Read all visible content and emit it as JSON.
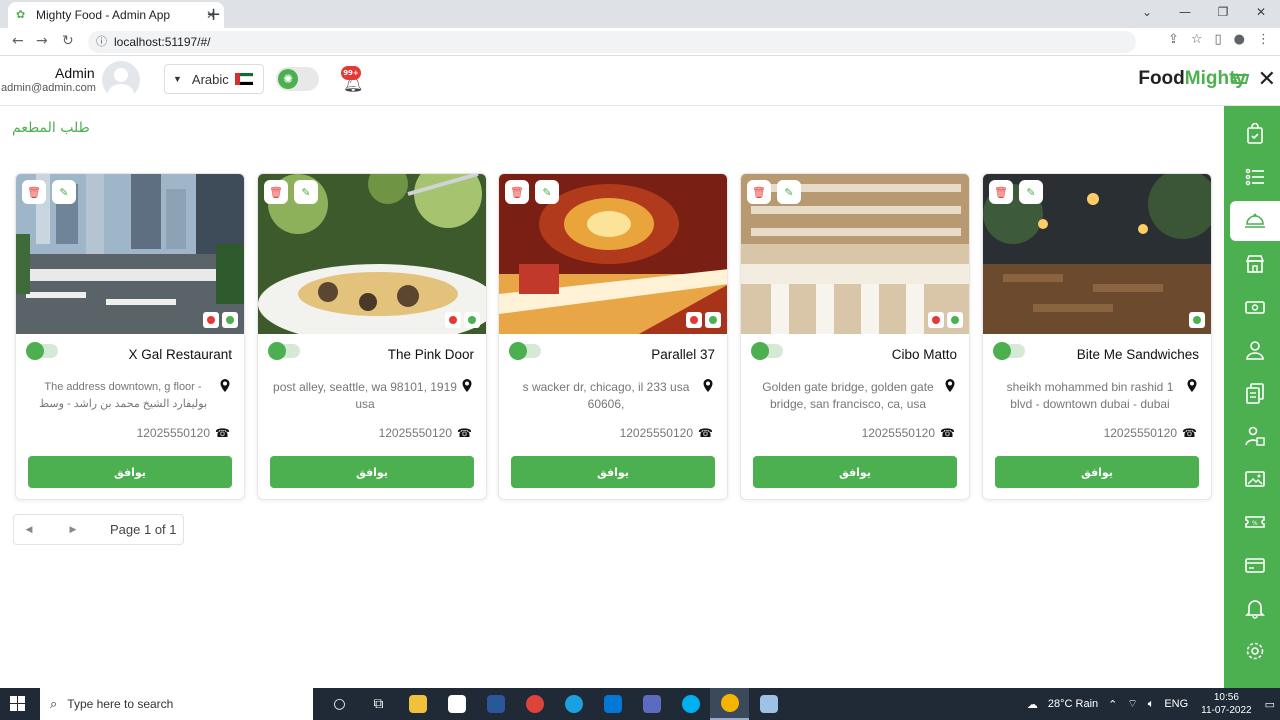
{
  "browser": {
    "tab_title": "Mighty Food - Admin App",
    "url": "localhost:51197/#/"
  },
  "header": {
    "admin_name": "Admin",
    "admin_email": "admin@admin.com",
    "language": "Arabic",
    "notification_badge": "99+",
    "brand_first": "Food",
    "brand_second": "Mighty"
  },
  "page": {
    "title": "طلب المطعم"
  },
  "colors": {
    "accent": "#4caf50",
    "danger": "#e53935"
  },
  "restaurants": [
    {
      "name": "X Gal Restaurant",
      "address": "The address downtown, g floor - بوليفارد الشيخ محمد بن راشد - وسط مدينة دبي -",
      "phone": "12025550120",
      "approve_label": "يوافق",
      "indicators": [
        "red",
        "green"
      ]
    },
    {
      "name": "The Pink Door",
      "address": "post alley, seattle, wa 98101, 1919 usa",
      "phone": "12025550120",
      "approve_label": "يوافق",
      "indicators": [
        "red",
        "green"
      ]
    },
    {
      "name": "Parallel 37",
      "address": "s wacker dr, chicago, il 233 usa 60606,",
      "phone": "12025550120",
      "approve_label": "يوافق",
      "indicators": [
        "red",
        "green"
      ]
    },
    {
      "name": "Cibo Matto",
      "address": "Golden gate bridge, golden gate bridge, san francisco, ca, usa",
      "phone": "12025550120",
      "approve_label": "يوافق",
      "indicators": [
        "red",
        "green"
      ]
    },
    {
      "name": "Bite Me Sandwiches",
      "address": "sheikh mohammed bin rashid 1 blvd - downtown dubai - dubai",
      "phone": "12025550120",
      "approve_label": "يوافق",
      "indicators": [
        "green"
      ]
    }
  ],
  "pagination": {
    "label": "Page 1 of 1"
  },
  "sidebar": {
    "items": [
      "orders-icon",
      "list-icon",
      "restaurant-request-icon",
      "store-icon",
      "payment-icon",
      "user-icon",
      "documents-icon",
      "delivery-man-icon",
      "banner-icon",
      "coupon-icon",
      "wallet-icon",
      "notification-icon",
      "settings-icon"
    ],
    "active_index": 2
  },
  "taskbar": {
    "search_placeholder": "Type here to search",
    "weather": "28°C  Rain",
    "lang": "ENG",
    "time": "10:56",
    "date": "11-07-2022"
  }
}
